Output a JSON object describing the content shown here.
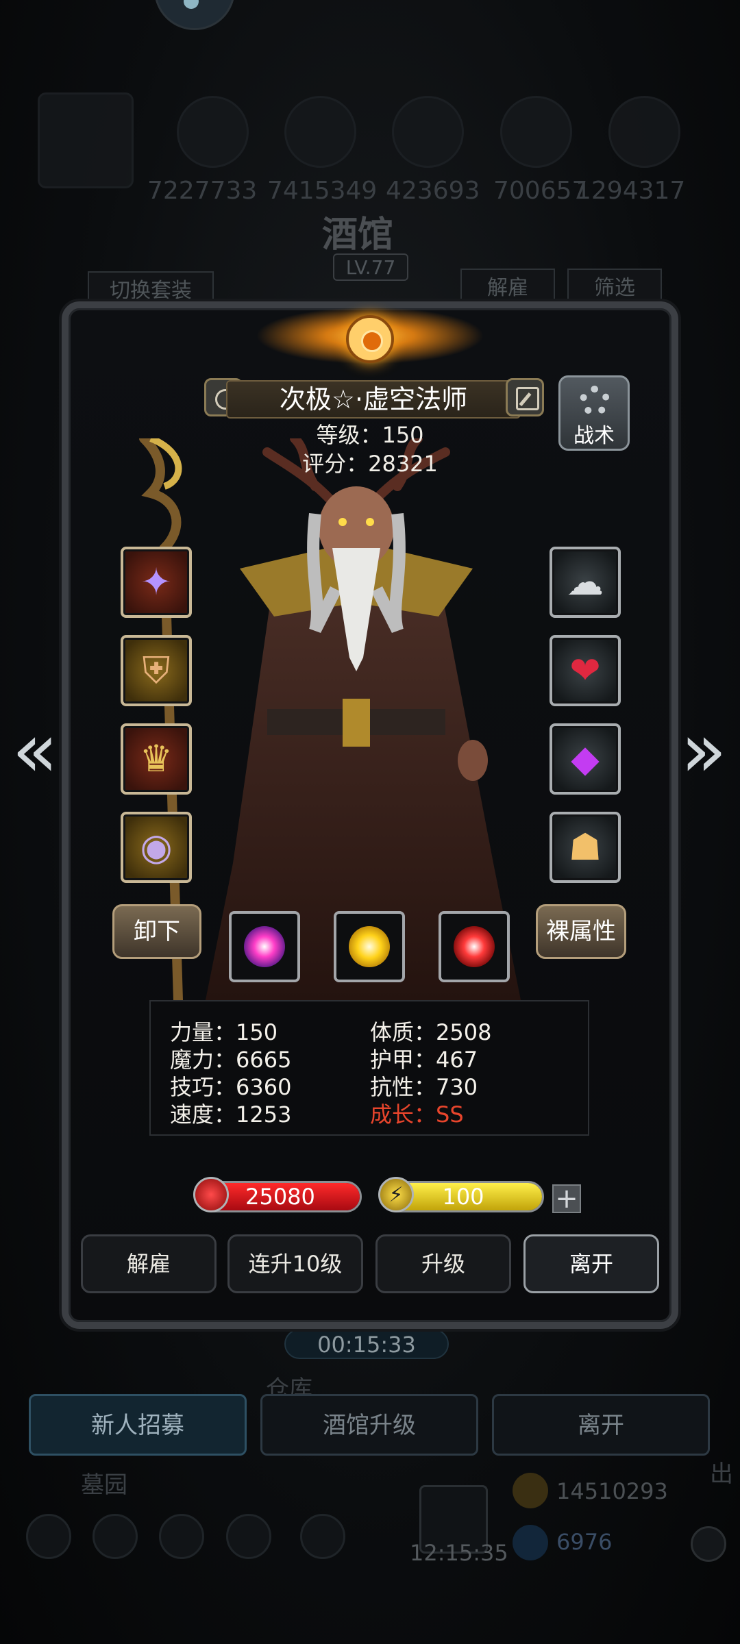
{
  "background": {
    "resources": [
      "7227733",
      "7415349",
      "423693",
      "700657",
      "1294317"
    ],
    "title": "酒馆",
    "level": "LV.77",
    "switch_outfit_label": "切换套装",
    "dismiss_label": "解雇",
    "filter_label": "筛选",
    "timer": "00:15:33",
    "warehouse_label": "仓库",
    "recruit_label": "新人招募",
    "tavern_upgrade_label": "酒馆升级",
    "leave_label": "离开",
    "cemetery_label": "墓园",
    "gold_amount": "14510293",
    "gem_amount": "6976",
    "gift_timer": "12:15:35",
    "exit_label": "出"
  },
  "hero": {
    "name": "次极☆·虚空法师",
    "level_text": "等级：150",
    "score_text": "评分：28321",
    "tactic_label": "战术",
    "unequip_label": "卸下",
    "bare_stats_label": "裸属性"
  },
  "attributes": {
    "strength": "力量：150",
    "magic": "魔力：6665",
    "skill": "技巧：6360",
    "speed": "速度：1253",
    "constitution": "体质：2508",
    "armor": "护甲：467",
    "resistance": "抗性：730",
    "growth": "成长：SS"
  },
  "bars": {
    "hp": "25080",
    "energy": "100",
    "hp_color": "#c4121a",
    "energy_color": "#d8c21a"
  },
  "actions": {
    "dismiss": "解雇",
    "level_up_10": "连升10级",
    "upgrade": "升级",
    "leave": "离开"
  },
  "icons": {
    "left_slots": [
      "staff-icon",
      "armor-icon",
      "helmet-icon",
      "ring-icon"
    ],
    "right_slots": [
      "cloud-amulet-icon",
      "heart-orb-icon",
      "purple-gem-icon",
      "lantern-icon"
    ]
  }
}
